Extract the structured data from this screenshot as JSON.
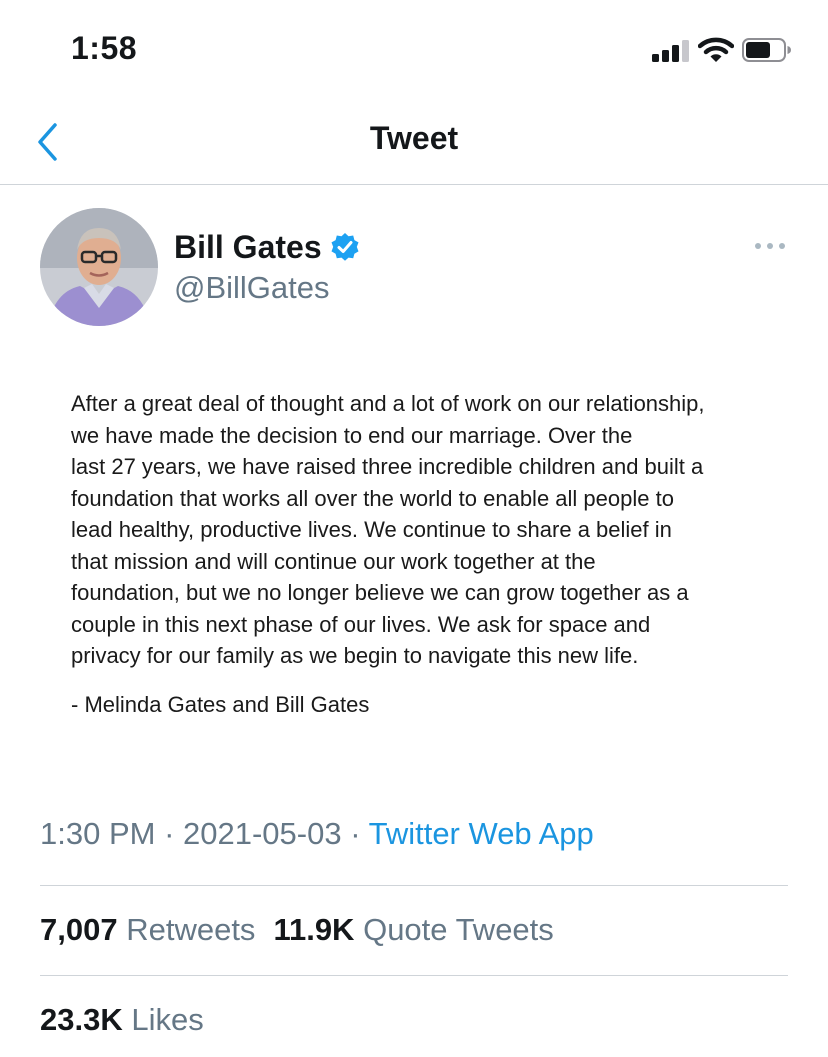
{
  "status_bar": {
    "time": "1:58"
  },
  "nav": {
    "title": "Tweet"
  },
  "author": {
    "name": "Bill Gates",
    "handle": "@BillGates"
  },
  "tweet": {
    "lines": [
      "After a great deal of thought and a lot of work on our relationship,",
      "we have made the decision to end our marriage. Over the",
      "last 27 years, we have raised three incredible children and built a",
      "foundation that works all over the world to enable all people to",
      "lead healthy, productive lives. We continue to share a belief in",
      "that mission and will continue our work together at the",
      "foundation, but we no longer believe we can grow together as a",
      "couple in this next phase of our lives. We ask for space and",
      "privacy for our family as we begin to navigate this new life."
    ],
    "signature": "- Melinda Gates and Bill Gates"
  },
  "meta": {
    "time": "1:30 PM",
    "sep": " · ",
    "date": "2021-05-03",
    "source": "Twitter Web App"
  },
  "stats": {
    "retweets_count": "7,007",
    "retweets_label": "Retweets",
    "quotes_count": "11.9K",
    "quotes_label": "Quote Tweets",
    "likes_count": "23.3K",
    "likes_label": "Likes"
  },
  "colors": {
    "accent": "#1b95e0",
    "secondary_text": "#657786",
    "divider": "#cfd4d9",
    "verified": "#1da1f2"
  },
  "icons": [
    "chevron-left-icon",
    "verified-badge-icon",
    "more-icon",
    "signal-icon",
    "wifi-icon",
    "battery-icon"
  ]
}
